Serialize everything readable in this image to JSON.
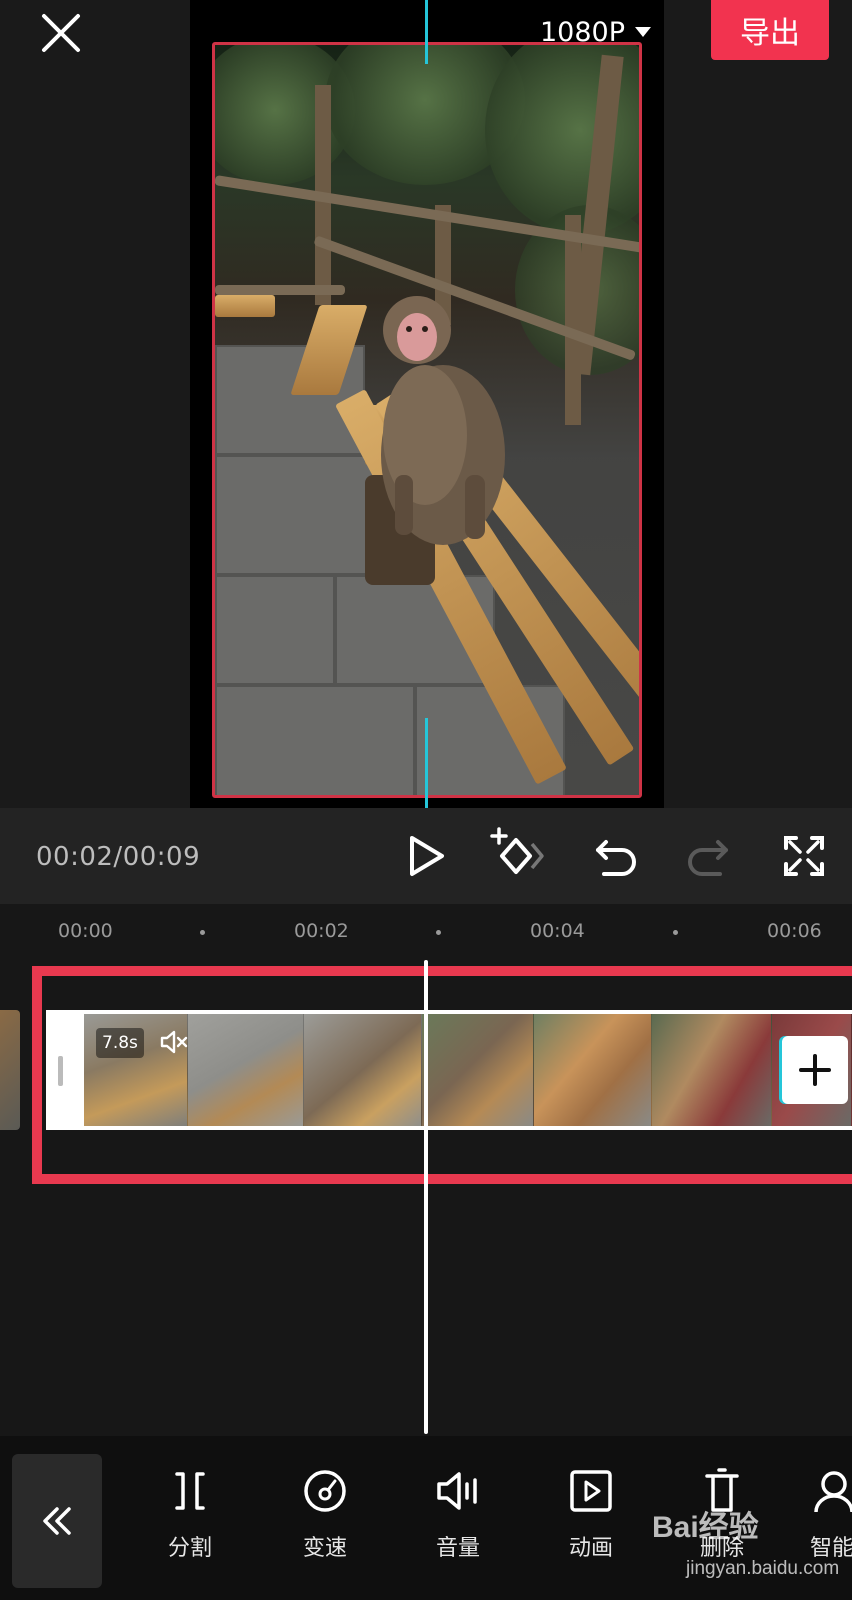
{
  "header": {
    "resolution_label": "1080P",
    "export_label": "导出",
    "accent_color": "#f2334f"
  },
  "icons": {
    "close": "close-icon",
    "resolution_dropdown": "caret-down-icon",
    "play": "play-icon",
    "keyframe": "keyframe-add-icon",
    "undo": "undo-icon",
    "redo": "redo-icon",
    "fullscreen": "fullscreen-icon",
    "mute": "mute-icon",
    "add_clip": "plus-icon",
    "collapse": "double-chevron-left-icon"
  },
  "controls": {
    "timecode": "00:02/00:09",
    "redo_enabled": false
  },
  "ruler": {
    "ticks": [
      "00:00",
      "00:02",
      "00:04",
      "00:06"
    ]
  },
  "track": {
    "clip_duration": "7.8s",
    "muted": true,
    "highlight_color": "#e8394f",
    "playhead_color": "#25c6d9"
  },
  "toolbar": {
    "tools": [
      {
        "label": "分割",
        "icon": "split-icon"
      },
      {
        "label": "变速",
        "icon": "speed-icon"
      },
      {
        "label": "音量",
        "icon": "volume-icon"
      },
      {
        "label": "动画",
        "icon": "animation-icon"
      },
      {
        "label": "删除",
        "icon": "delete-icon"
      },
      {
        "label": "智能",
        "icon": "smart-icon"
      }
    ]
  },
  "watermark": {
    "brand": "Bai经验",
    "url": "jingyan.baidu.com"
  }
}
